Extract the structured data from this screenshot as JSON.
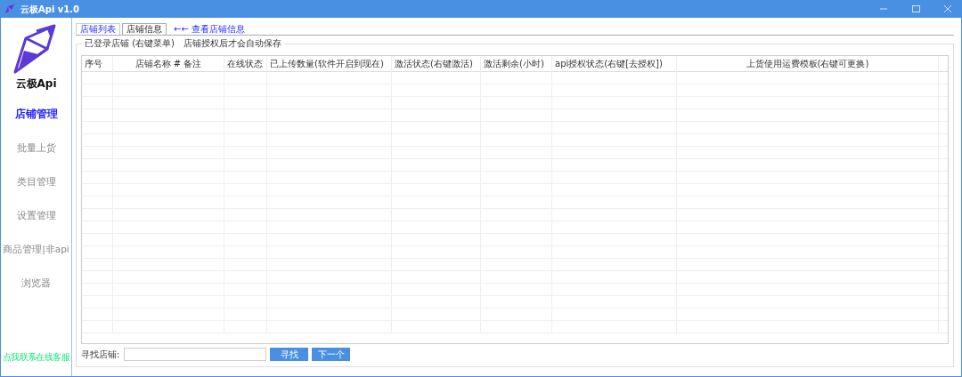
{
  "window": {
    "title": "云极Api v1.0"
  },
  "sidebar": {
    "brand": "云极Api",
    "items": [
      {
        "label": "店铺管理",
        "selected": true
      },
      {
        "label": "批量上货",
        "selected": false
      },
      {
        "label": "类目管理",
        "selected": false
      },
      {
        "label": "设置管理",
        "selected": false
      },
      {
        "label": "商品管理|非api",
        "selected": false
      },
      {
        "label": "浏览器",
        "selected": false
      }
    ],
    "contact_link": "点我联系在线客服"
  },
  "tabs": [
    {
      "label": "店铺列表",
      "selected": true
    },
    {
      "label": "店铺信息",
      "selected": false
    }
  ],
  "tab_hint": "←← 查看店铺信息",
  "group": {
    "title": "已登录店铺 (右键菜单)",
    "note": "店铺授权后才会自动保存"
  },
  "table": {
    "columns": [
      {
        "label": "序号"
      },
      {
        "label": "店铺名称 # 备注"
      },
      {
        "label": "在线状态"
      },
      {
        "label": "已上传数量(软件开启到现在)"
      },
      {
        "label": "激活状态(右键激活)"
      },
      {
        "label": "激活剩余(小时)"
      },
      {
        "label": "api授权状态(右键[去授权])"
      },
      {
        "label": "上货使用运费模板(右键可更换)"
      }
    ]
  },
  "search": {
    "label": "寻找店铺:",
    "buttons": [
      "寻找",
      "下一个"
    ]
  }
}
